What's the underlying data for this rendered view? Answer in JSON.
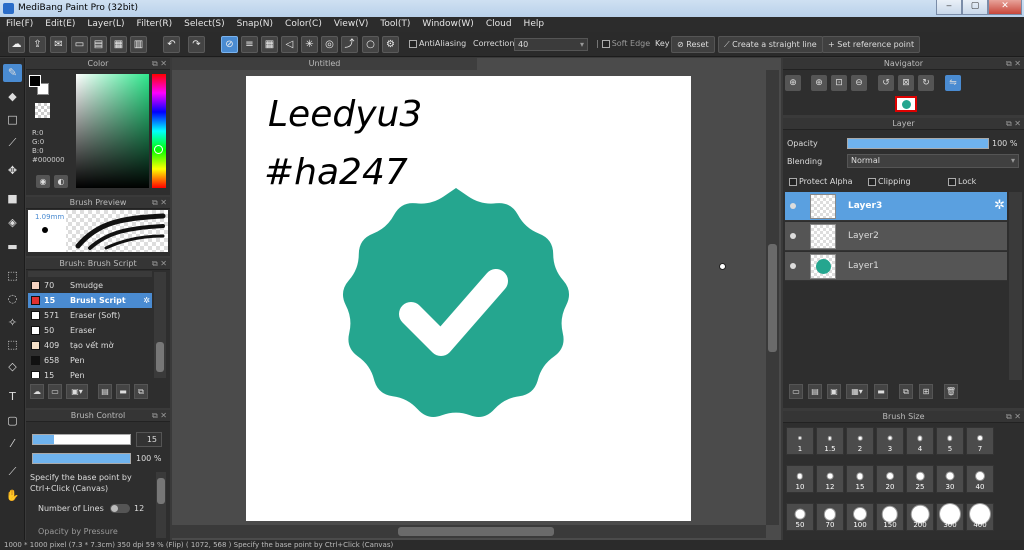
{
  "window": {
    "title": "MediBang Paint Pro (32bit)",
    "minimize": "‒",
    "maximize": "▢",
    "close": "✕"
  },
  "menu": [
    "File(F)",
    "Edit(E)",
    "Layer(L)",
    "Filter(R)",
    "Select(S)",
    "Snap(N)",
    "Color(C)",
    "View(V)",
    "Tool(T)",
    "Window(W)",
    "Cloud",
    "Help"
  ],
  "toolbar": {
    "antialiasing": "AntiAliasing",
    "correction_label": "Correction",
    "correction_value": "40",
    "soft_edge": "Soft Edge",
    "key": "Key",
    "reset": "Reset",
    "straight_line": "Create a straight line",
    "reference_point": "Set reference point"
  },
  "color_panel": {
    "title": "Color",
    "r": "R:0",
    "g": "G:0",
    "b": "B:0",
    "hex": "#000000",
    "foreground": "#000000",
    "background": "#ffffff"
  },
  "brush_preview": {
    "title": "Brush Preview",
    "size": "1.09mm"
  },
  "brush_panel": {
    "title": "Brush: Brush Script",
    "items": [
      {
        "num": "70",
        "label": "Smudge",
        "color": "#f3d2c0"
      },
      {
        "num": "15",
        "label": "Brush Script",
        "color": "#e03030"
      },
      {
        "num": "571",
        "label": "Eraser (Soft)",
        "color": "#ffffff"
      },
      {
        "num": "50",
        "label": "Eraser",
        "color": "#ffffff"
      },
      {
        "num": "409",
        "label": "tạo vết mờ",
        "color": "#f4e0c8"
      },
      {
        "num": "658",
        "label": "Pen",
        "color": "#111111"
      },
      {
        "num": "15",
        "label": "Pen",
        "color": "#ffffff"
      }
    ]
  },
  "brush_control": {
    "title": "Brush Control",
    "size_value": "15",
    "size_fill": 0.22,
    "opacity_value": "100 %",
    "opacity_fill": 1.0,
    "hint": "Specify the base point by Ctrl+Click (Canvas)",
    "lines_label": "Number of Lines",
    "lines_value": "12",
    "pressure_label": "Opacity by Pressure"
  },
  "canvas": {
    "tab": "Untitled",
    "text_line1": "Leedyu3",
    "text_line2": "#ha247",
    "badge_color": "#25a68f"
  },
  "navigator": {
    "title": "Navigator"
  },
  "layer_panel": {
    "title": "Layer",
    "opacity_label": "Opacity",
    "opacity_value": "100 %",
    "blending_label": "Blending",
    "blending_value": "Normal",
    "protect_alpha": "Protect Alpha",
    "clipping": "Clipping",
    "lock": "Lock",
    "layers": [
      {
        "name": "Layer3"
      },
      {
        "name": "Layer2"
      },
      {
        "name": "Layer1"
      }
    ]
  },
  "brush_size": {
    "title": "Brush Size",
    "sizes": [
      "1",
      "1.5",
      "2",
      "3",
      "4",
      "5",
      "7",
      "10",
      "12",
      "15",
      "20",
      "25",
      "30",
      "40",
      "50",
      "70",
      "100",
      "150",
      "200",
      "300",
      "400"
    ]
  },
  "status": "1000 * 1000 pixel  (7.3 * 7.3cm)  350 dpi  59 % (Flip)  ( 1072, 568 )  Specify the base point by Ctrl+Click (Canvas)"
}
